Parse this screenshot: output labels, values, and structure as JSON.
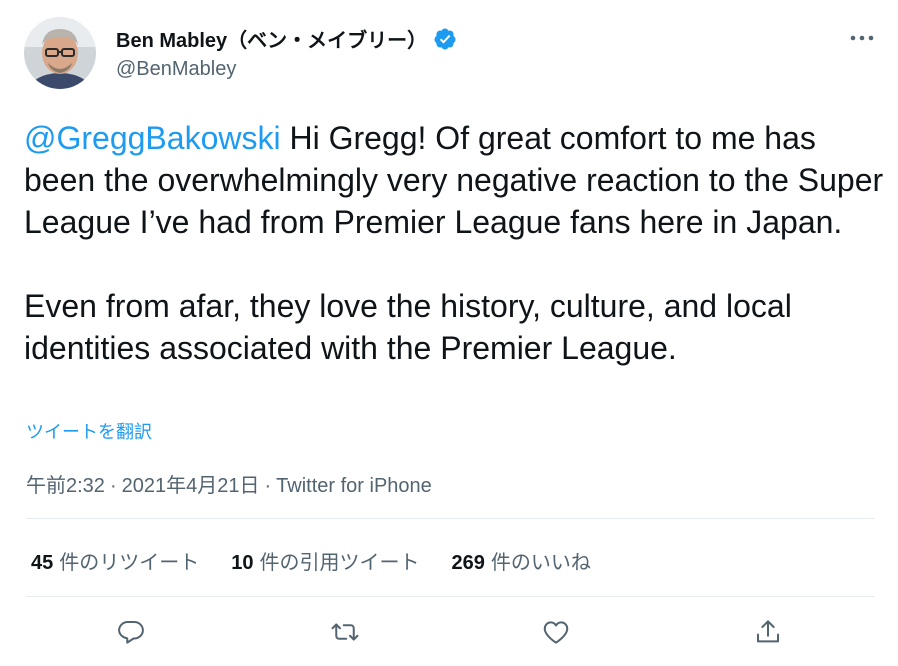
{
  "colors": {
    "accent": "#1d9bf0",
    "secondary_text": "#536471",
    "primary_text": "#0f1419",
    "divider": "#e6ecf0"
  },
  "author": {
    "display_name": "Ben Mabley（ベン・メイブリー）",
    "handle": "@BenMabley",
    "verified": true,
    "avatar_icon": "user-avatar"
  },
  "tweet": {
    "mention": "@GreggBakowski",
    "text": " Hi Gregg! Of great comfort to me has been the overwhelmingly very negative reaction to the Super League I’ve had from Premier League fans here in Japan.\n\nEven from afar, they love the history, culture, and local identities associated with the Premier League.",
    "translate_label": "ツイートを翻訳"
  },
  "meta": {
    "time": "午前2:32",
    "separator": "·",
    "date": "2021年4月21日",
    "source": "Twitter for iPhone"
  },
  "stats": {
    "retweets_count": "45",
    "retweets_label": "件のリツイート",
    "quotes_count": "10",
    "quotes_label": "件の引用ツイート",
    "likes_count": "269",
    "likes_label": "件のいいね"
  },
  "actions": [
    "reply-icon",
    "retweet-icon",
    "like-icon",
    "share-icon"
  ]
}
